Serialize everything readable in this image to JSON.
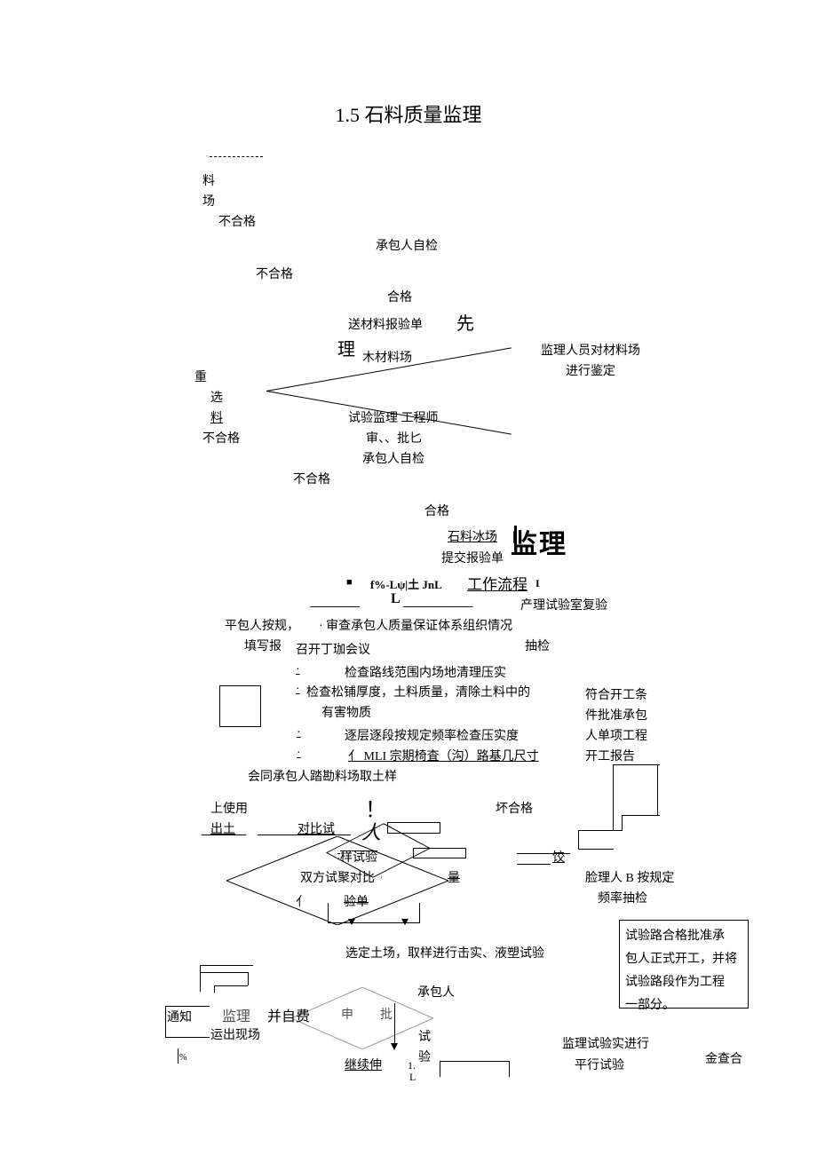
{
  "title": "1.5 石料质量监理",
  "labels": {
    "liao": "料",
    "chang": "场",
    "buhege1": "不合格",
    "chengbaoren_zijian1": "承包人自检",
    "buhege2": "不合格",
    "hege1": "合格",
    "song_cailiao": "送材料报验单",
    "xian": "先",
    "li": "理",
    "mucailiaochang": "木材料场",
    "jianli_duicailiao": "监理人员对材料场",
    "jinxing_jianding": "进行鉴定",
    "zhong": "重",
    "xuan": "选",
    "liao2": "料",
    "buhege3": "不合格",
    "shiyan_jianli": "试验监理 工程师",
    "shen_pi": "审、、批匕",
    "chengbaoren_zijian2": "承包人自检",
    "buhege4": "不合格",
    "hege2": "合格",
    "shiliao_bingchang": "石料冰场",
    "jianli_big": "监理",
    "tijiao_baoyandan": "提交报验单",
    "square": "■",
    "flt": "f%-Lψ|土 JnL",
    "gongzuo_liucheng": "工作流程",
    "I": "I",
    "L": "L",
    "chan_shiyanshi": "产理试验室复验",
    "pingbaoren": "平包人按规，",
    "tianxie_bao": "填写报",
    "shencha_chengbaoren": "审查承包人质量保证体系组织情况",
    "choujian": "抽检",
    "zhaokai_huiyi": "召开丁珈会议",
    "dot1": "·",
    "jiancha_luxian": "检查路线范围内场地清理压实",
    "dot2": "·",
    "jiancha_songpu": "检查松铺厚度，土料质量，清除土料中的",
    "youhai_wuzhi": "有害物质",
    "fuhe_kaigong": "符合开工条",
    "jian_pizhun": "件批准承包",
    "ren_danxiang": "人单项工程",
    "kaigong_baogao": "开工报告",
    "dot3": "·",
    "zhuceng_zhuduan": "逐层逐段按规定频率检查压实度",
    "dot4": "·",
    "mli_zongqi": "亻 MLI 宗期椅査（沟）路基几尺寸",
    "huitong": "会同承包人踏勘料场取土样",
    "shang_shiyong": "上使用",
    "chutu": "出土",
    "duibi_shiji": "对比试",
    "tan": "！",
    "huai_hege": "坏合格",
    "ren": "人",
    "yang_shiyan": "样试验",
    "jiao": "饺",
    "shuangfang_shiju": "双方试聚对比",
    "liang": "量",
    "lianren_b": "脸理人 B 按规定",
    "pinlv_choujian": "频率抽检",
    "cai": "亻",
    "yandan": "验单",
    "shiyanlu_hege": "试验路合格批准承",
    "baoren_zhengshi": "包人正式开工，并将",
    "shiyanluduan": "试验路段作为工程",
    "yibufen": "一部分。",
    "xuanding_tuchang": "选定土场，取样进行击实、液塑试验",
    "chengbaoren": "承包人",
    "tongzhi": "通知",
    "jianli2": "监理",
    "bing_zifei": "并自费",
    "shen": "申",
    "pi": "批",
    "yunchu_xianchang": "运出现场",
    "shi": "试",
    "yan": "验",
    "jianli_shiyan": "监理试验实进行",
    "percent": "%",
    "jixu_shen": "继续伸",
    "one_dot": "1.",
    "L2": "L",
    "pingxing_shiyan": "平行试验",
    "jin_cha_he": "金查合"
  }
}
